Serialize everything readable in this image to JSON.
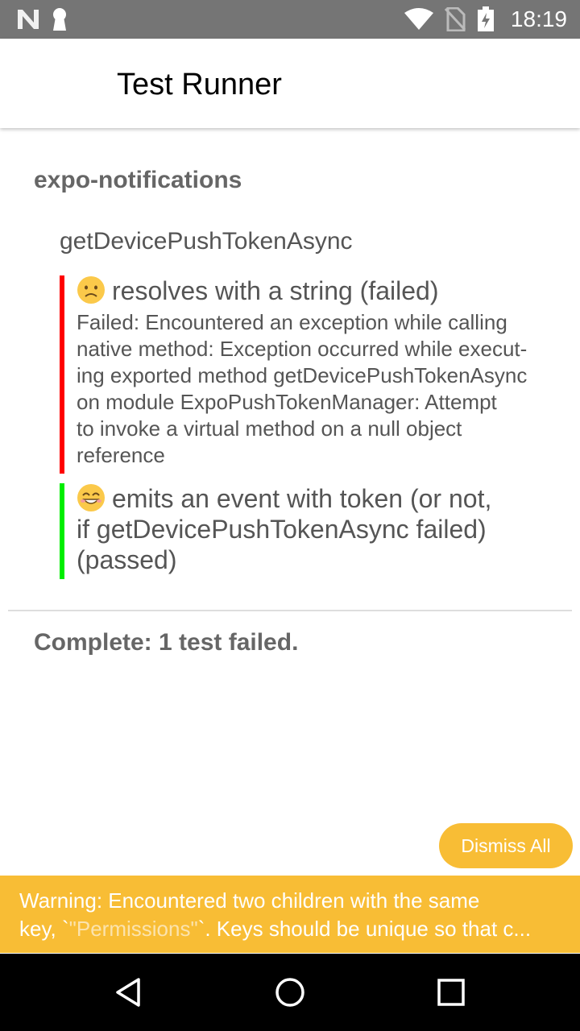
{
  "status_bar": {
    "time": "18:19",
    "icons": [
      "n-notification-icon",
      "keyhole-icon",
      "wifi-icon",
      "no-sim-icon",
      "battery-charging-icon"
    ]
  },
  "app_bar": {
    "title": "Test Runner"
  },
  "suite": {
    "title": "expo-notifications",
    "describe": "getDevicePushTokenAsync",
    "tests": [
      {
        "status": "failed",
        "emoji": "sad-face-emoji",
        "bar_color": "#ff0000",
        "title": "resolves with a string (failed)",
        "error_lines": [
          "Failed: Encountered an exception while calling",
          "native method: Exception occurred while execut-",
          "ing exported method getDevicePushTokenAsync",
          "on module ExpoPushTokenManager: Attempt",
          "to invoke a virtual method on a null object",
          "reference"
        ]
      },
      {
        "status": "passed",
        "emoji": "smiling-face-emoji",
        "bar_color": "#00ee00",
        "title_lines": [
          "emits an event with token (or not,",
          "if getDevicePushTokenAsync failed)",
          "(passed)"
        ]
      }
    ]
  },
  "summary": "Complete: 1 test failed.",
  "dismiss_button": {
    "label": "Dismiss All"
  },
  "warning": {
    "line1": "Warning: Encountered two children with the same",
    "line2_prefix": "key, `",
    "line2_key": "\"Permissions\"",
    "line2_suffix": "`. Keys should be unique so that c..."
  },
  "colors": {
    "accent": "#f8bd35",
    "status_bar": "#757575"
  }
}
